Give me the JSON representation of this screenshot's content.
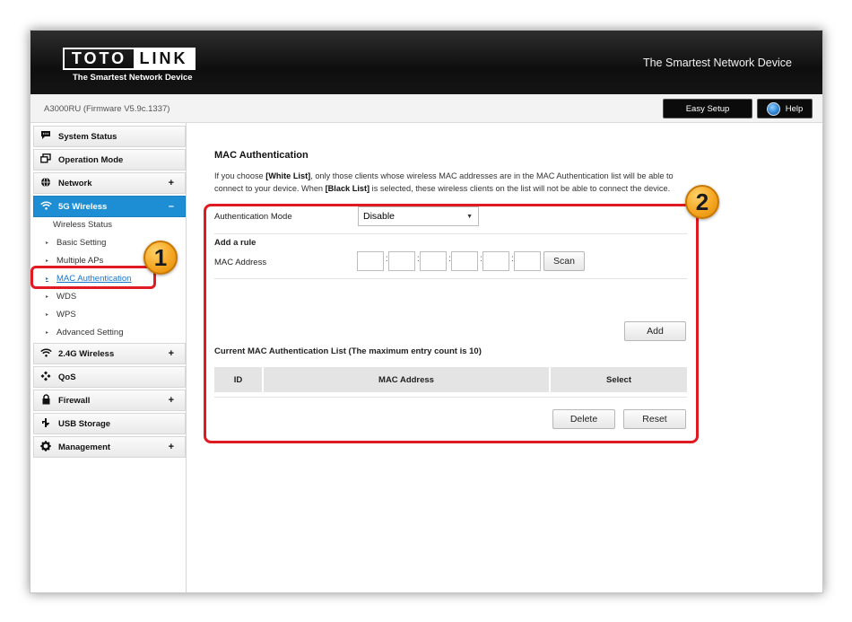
{
  "header": {
    "logo_left": "TOTO",
    "logo_right": "LINK",
    "logo_tagline": "The Smartest Network Device",
    "slogan": "The Smartest Network Device",
    "model": "A3000RU (Firmware V5.9c.1337)",
    "easy_setup_label": "Easy Setup",
    "help_label": "Help"
  },
  "sidebar": {
    "system_status": "System Status",
    "operation_mode": "Operation Mode",
    "network": "Network",
    "wireless_5g": "5G Wireless",
    "wireless_5g_sub": [
      "Wireless Status",
      "Basic Setting",
      "Multiple APs",
      "MAC Authentication",
      "WDS",
      "WPS",
      "Advanced Setting"
    ],
    "wireless_24g": "2.4G Wireless",
    "qos": "QoS",
    "firewall": "Firewall",
    "usb_storage": "USB Storage",
    "management": "Management",
    "plus": "+",
    "minus": "–"
  },
  "main": {
    "title": "MAC Authentication",
    "desc_part1": "If you choose ",
    "white_list": "[White List]",
    "desc_part2": ", only those clients whose wireless MAC addresses are in the MAC Authentication list will be able to connect to your device. When ",
    "black_list": "[Black List]",
    "desc_part3": " is selected, these wireless clients on the list will not be able to connect the device.",
    "auth_mode_label": "Authentication Mode",
    "auth_mode_value": "Disable",
    "add_rule_label": "Add a rule",
    "mac_address_label": "MAC Address",
    "scan_label": "Scan",
    "add_label": "Add",
    "list_title": "Current MAC Authentication List (The maximum entry count is 10)",
    "table_headers": [
      "ID",
      "MAC Address",
      "Select"
    ],
    "delete_label": "Delete",
    "reset_label": "Reset"
  },
  "annotations": {
    "badge1": "1",
    "badge2": "2",
    "color": "#e01a22"
  }
}
